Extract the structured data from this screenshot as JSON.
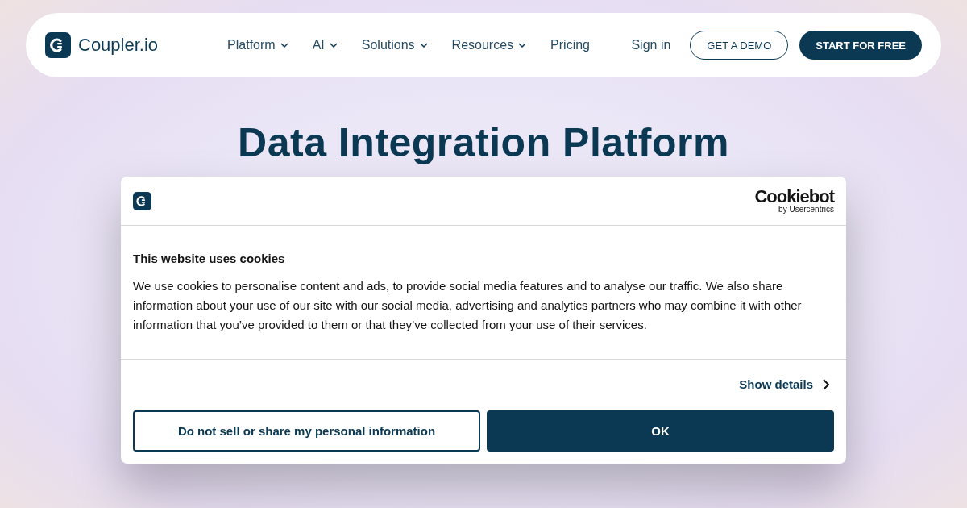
{
  "header": {
    "logo": "Coupler.io",
    "nav": [
      {
        "label": "Platform",
        "has_menu": true
      },
      {
        "label": "AI",
        "has_menu": true
      },
      {
        "label": "Solutions",
        "has_menu": true
      },
      {
        "label": "Resources",
        "has_menu": true
      },
      {
        "label": "Pricing",
        "has_menu": false
      }
    ],
    "sign_in": "Sign in",
    "demo_button": "GET A DEMO",
    "start_button": "START FOR FREE"
  },
  "hero": {
    "title": "Data Integration Platform"
  },
  "cookie_dialog": {
    "brand": "Cookiebot",
    "brand_sub": "by Usercentrics",
    "title": "This website uses cookies",
    "text": "We use cookies to personalise content and ads, to provide social media features and to analyse our traffic. We also share information about your use of our site with our social media, advertising and analytics partners who may combine it with other information that you’ve provided to them or that they’ve collected from your use of their services.",
    "details_link": "Show details",
    "buttons": [
      {
        "label": "Do not sell or share my personal information",
        "kind": "outline"
      },
      {
        "label": "OK",
        "kind": "primary"
      }
    ]
  }
}
